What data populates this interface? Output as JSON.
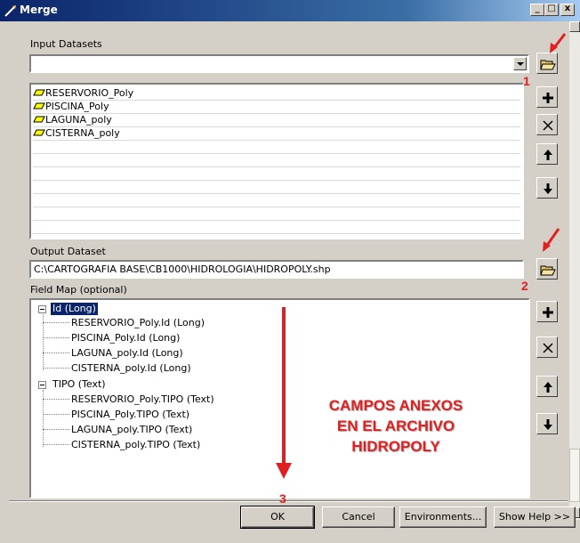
{
  "window": {
    "title": "Merge",
    "min_glyph": "_",
    "max_glyph": "□",
    "close_glyph": "x"
  },
  "input": {
    "label": "Input Datasets",
    "value": "",
    "items": [
      "RESERVORIO_Poly",
      "PISCINA_Poly",
      "LAGUNA_poly",
      "CISTERNA_poly"
    ]
  },
  "output": {
    "label": "Output Dataset",
    "value": "C:\\CARTOGRAFIA BASE\\CB1000\\HIDROLOGIA\\HIDROPOLY.shp"
  },
  "fieldmap": {
    "label": "Field Map (optional)",
    "nodes": [
      {
        "label": "Id (Long)",
        "children": [
          "RESERVORIO_Poly.Id (Long)",
          "PISCINA_Poly.Id (Long)",
          "LAGUNA_poly.Id (Long)",
          "CISTERNA_poly.Id (Long)"
        ]
      },
      {
        "label": "TIPO (Text)",
        "children": [
          "RESERVORIO_Poly.TIPO (Text)",
          "PISCINA_Poly.TIPO (Text)",
          "LAGUNA_poly.TIPO (Text)",
          "CISTERNA_poly.TIPO (Text)"
        ]
      }
    ]
  },
  "buttons": {
    "ok": "OK",
    "cancel": "Cancel",
    "environments": "Environments...",
    "help": "Show Help >>"
  },
  "annotations": {
    "num1": "1",
    "num2": "2",
    "num3": "3",
    "line1": "CAMPOS ANEXOS",
    "line2": "EN EL ARCHIVO",
    "line3": "HIDROPOLY"
  },
  "colors": {
    "accent_red": "#e02020",
    "titlebar": "#0a246a",
    "feature_yellow": "#ffff00",
    "folder": "#e8c86a"
  },
  "icons": [
    "open-folder-icon",
    "add-icon",
    "delete-icon",
    "move-up-icon",
    "move-down-icon",
    "polygon-feature-icon",
    "arrow-icon"
  ]
}
